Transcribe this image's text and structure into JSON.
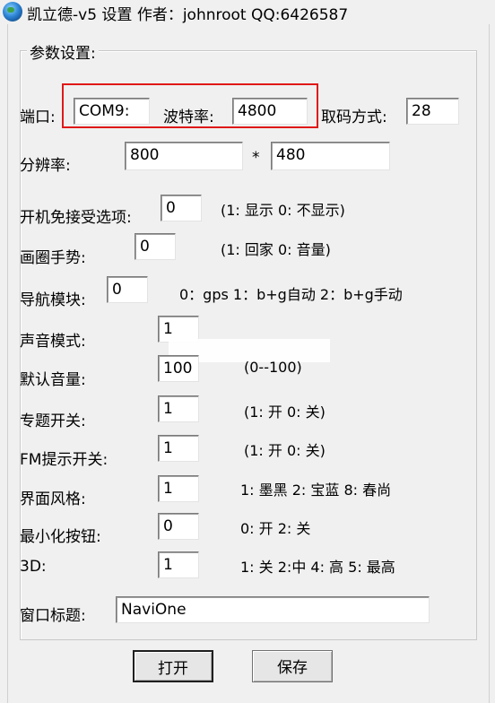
{
  "window": {
    "title": "凯立德-v5 设置  作者：johnroot  QQ:6426587"
  },
  "group": {
    "title": "参数设置:"
  },
  "port": {
    "label": "端口:",
    "value": "COM9:"
  },
  "baud": {
    "label": "波特率:",
    "value": "4800"
  },
  "mode": {
    "label": "取码方式:",
    "value": "28"
  },
  "resolution": {
    "label": "分辨率:",
    "width": "800",
    "sep": "*",
    "height": "480"
  },
  "fields": [
    {
      "label": "开机免接受选项:",
      "value": "0",
      "hint": "(1: 显示 0: 不显示)"
    },
    {
      "label": "画圈手势:",
      "value": "0",
      "hint": "(1: 回家 0: 音量)"
    },
    {
      "label": "导航模块:",
      "value": "0",
      "hint": "0：gps  1：b+g自动  2：b+g手动"
    },
    {
      "label": "声音模式:",
      "value": "1",
      "hint": ""
    },
    {
      "label": "默认音量:",
      "value": "100",
      "hint": "(0--100)"
    },
    {
      "label": "专题开关:",
      "value": "1",
      "hint": "(1: 开 0: 关)"
    },
    {
      "label": "FM提示开关:",
      "value": "1",
      "hint": "(1: 开 0: 关)"
    },
    {
      "label": "界面风格:",
      "value": "1",
      "hint": "1: 墨黑  2: 宝蓝  8: 春尚"
    },
    {
      "label": "最小化按钮:",
      "value": "0",
      "hint": "0: 开 2: 关"
    },
    {
      "label": "3D:",
      "value": "1",
      "hint": "1: 关 2:中 4: 高 5: 最高"
    }
  ],
  "window_title_field": {
    "label": "窗口标题:",
    "value": "NaviOne"
  },
  "buttons": {
    "open": "打开",
    "save": "保存"
  }
}
